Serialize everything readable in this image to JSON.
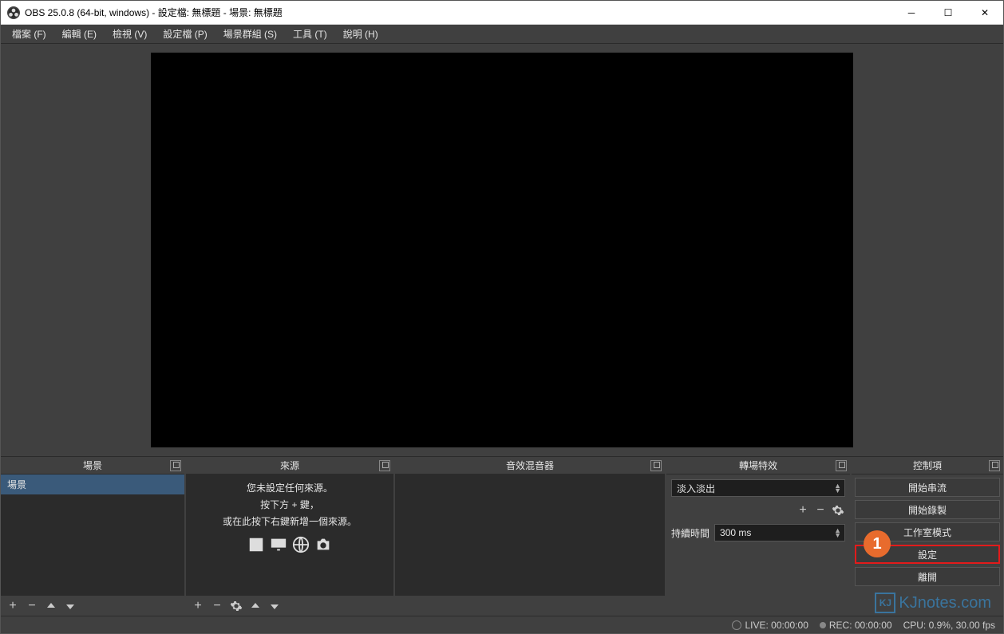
{
  "titlebar": {
    "title": "OBS 25.0.8 (64-bit, windows) - 設定檔: 無標題 - 場景: 無標題"
  },
  "menu": {
    "file": "檔案 (F)",
    "edit": "編輯 (E)",
    "view": "檢視 (V)",
    "profile": "設定檔 (P)",
    "scene_collection": "場景群組 (S)",
    "tools": "工具 (T)",
    "help": "說明 (H)"
  },
  "docks": {
    "scenes": {
      "title": "場景",
      "item": "場景"
    },
    "sources": {
      "title": "來源",
      "line1": "您未設定任何來源。",
      "line2": "按下方 + 鍵，",
      "line3": "或在此按下右鍵新增一個來源。"
    },
    "mixer": {
      "title": "音效混音器"
    },
    "transitions": {
      "title": "轉場特效",
      "selected": "淡入淡出",
      "duration_label": "持續時間",
      "duration_value": "300 ms"
    },
    "controls": {
      "title": "控制項",
      "start_stream": "開始串流",
      "start_record": "開始錄製",
      "studio_mode": "工作室模式",
      "settings": "設定",
      "exit": "離開"
    }
  },
  "status": {
    "live": "LIVE: 00:00:00",
    "rec": "REC: 00:00:00",
    "cpu": "CPU: 0.9%, 30.00 fps"
  },
  "annotation": {
    "num": "1"
  },
  "watermark": {
    "text": "KJnotes.com",
    "badge": "KJ"
  }
}
